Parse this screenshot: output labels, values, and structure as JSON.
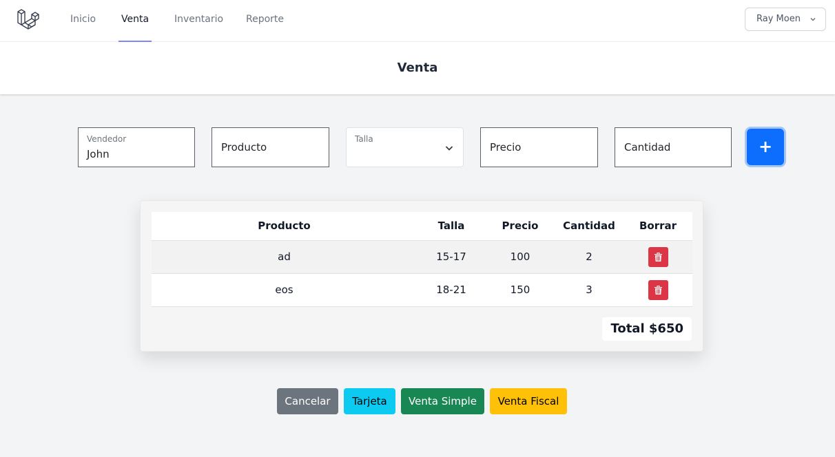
{
  "nav": {
    "logo": "laravel-logo",
    "links": [
      {
        "label": "Inicio",
        "active": false
      },
      {
        "label": "Venta",
        "active": true
      },
      {
        "label": "Inventario",
        "active": false
      },
      {
        "label": "Reporte",
        "active": false
      }
    ],
    "user_name": "Ray Moen"
  },
  "header": {
    "title": "Venta"
  },
  "form": {
    "vendedor_label": "Vendedor",
    "vendedor_value": "John",
    "producto_placeholder": "Producto",
    "talla_label": "Talla",
    "talla_value": "",
    "precio_placeholder": "Precio",
    "cantidad_placeholder": "Cantidad",
    "add_label": "+"
  },
  "table": {
    "headers": [
      "Producto",
      "Talla",
      "Precio",
      "Cantidad",
      "Borrar"
    ],
    "rows": [
      {
        "producto": "ad",
        "talla": "15-17",
        "precio": "100",
        "cantidad": "2"
      },
      {
        "producto": "eos",
        "talla": "18-21",
        "precio": "150",
        "cantidad": "3"
      }
    ],
    "total": "Total $650"
  },
  "actions": {
    "cancel": "Cancelar",
    "card": "Tarjeta",
    "simple": "Venta Simple",
    "fiscal": "Venta Fiscal"
  },
  "colors": {
    "primary": "#0d6efd",
    "danger": "#dc3545",
    "secondary": "#6c757d",
    "info": "#0dcaf0",
    "success": "#198754",
    "warning": "#ffc107",
    "nav_active": "#818cf8"
  }
}
